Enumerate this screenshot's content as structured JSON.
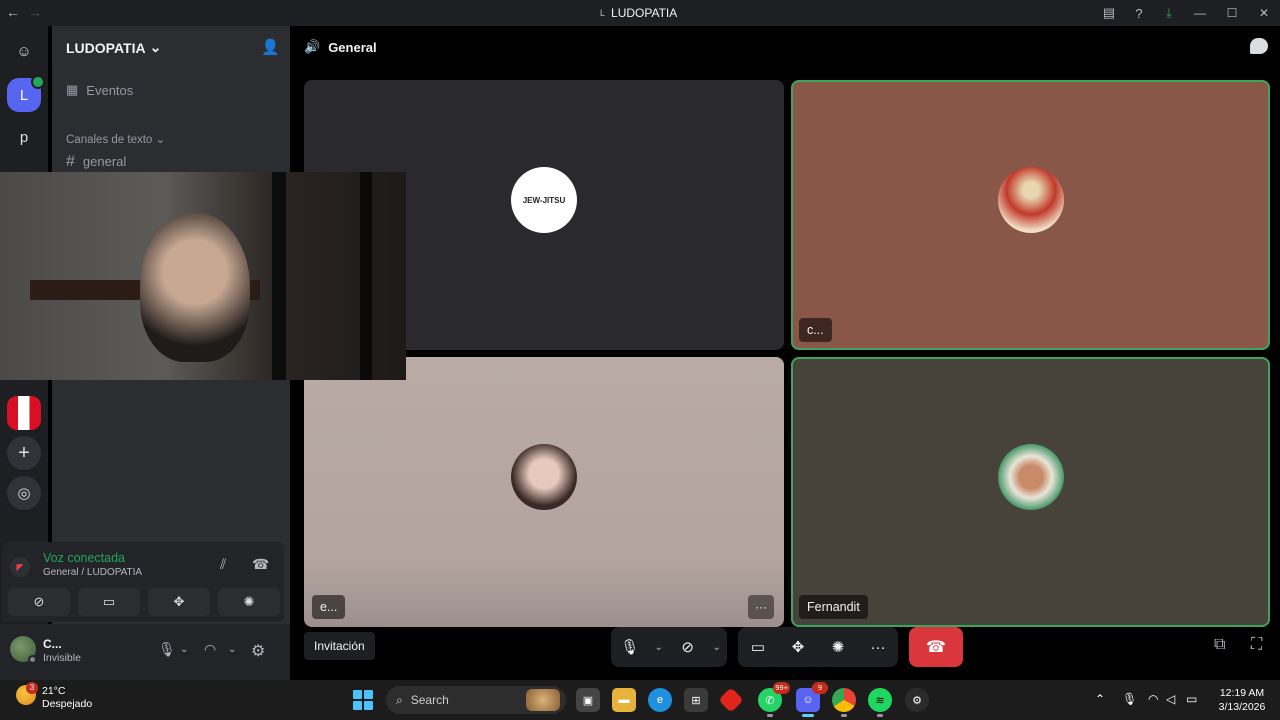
{
  "titlebar": {
    "title": "LUDOPATIA",
    "back": "←",
    "forward": "→"
  },
  "guilds": {
    "l_server": "L",
    "p_server": "p"
  },
  "sidebar": {
    "server_name": "LUDOPATIA",
    "events_label": "Eventos",
    "category_label": "Canales de texto",
    "channel_name": "general"
  },
  "voice": {
    "status": "Voz conectada",
    "location": "General / LUDOPATIA"
  },
  "user": {
    "name": "C...",
    "status": "Invisible"
  },
  "call": {
    "channel_title": "General",
    "tiles": [
      {
        "avatar_text": "JEW-JITSU",
        "label": ""
      },
      {
        "avatar_text": "",
        "label": "c..."
      },
      {
        "avatar_text": "",
        "label": "e..."
      },
      {
        "avatar_text": "",
        "label": "Fernandit"
      }
    ],
    "more_label": "···",
    "invite_label": "Invitación"
  },
  "taskbar": {
    "weather_badge": "3",
    "temperature": "21°C",
    "condition": "Despejado",
    "search_placeholder": "Search",
    "whatsapp_badge": "99+",
    "discord_badge": "9",
    "time": "12:19 AM",
    "date": "3/13/2026"
  },
  "colors": {
    "accent": "#5865f2",
    "connected": "#23a55a",
    "hangup": "#da373c",
    "speaking_border": "#3ba55c"
  }
}
